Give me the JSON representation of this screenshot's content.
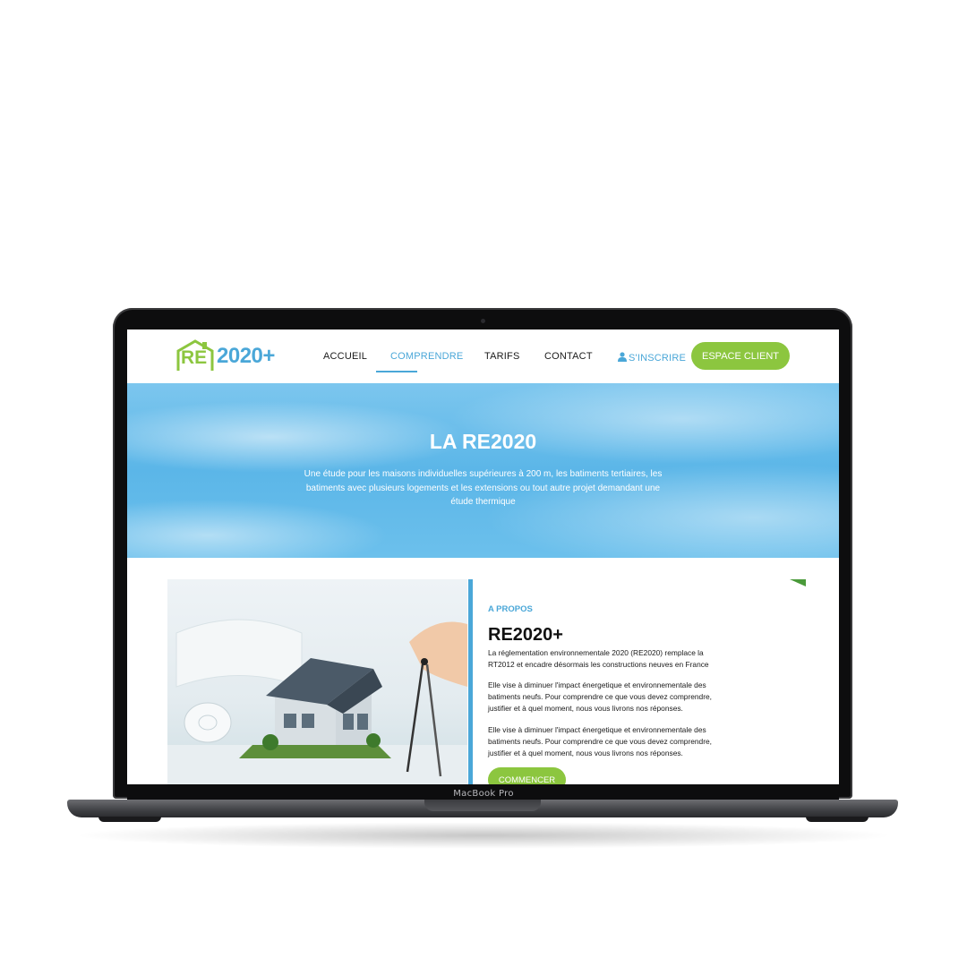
{
  "device": {
    "brand_label": "MacBook Pro"
  },
  "site": {
    "logo": {
      "re": "RE",
      "text": "2020+"
    },
    "nav": {
      "items": [
        "ACCUEIL",
        "COMPRENDRE",
        "TARIFS",
        "CONTACT"
      ],
      "active_item": "COMPRENDRE",
      "signup_label": "S'INSCRIRE",
      "cta_label": "ESPACE CLIENT"
    },
    "hero": {
      "title": "LA RE2020",
      "subtitle": "Une étude pour les maisons individuelles supérieures à 200 m, les batiments tertiaires, les batiments avec plusieurs logements et les extensions ou tout autre projet demandant une étude thermique"
    },
    "about": {
      "label": "A PROPOS",
      "title": "RE2020+",
      "paragraphs": [
        "La réglementation environnementale 2020 (RE2020) remplace la RT2012 et encadre désormais les constructions neuves en France",
        "Elle vise à diminuer l'impact énergetique et environnementale des batiments neufs. Pour comprendre ce que vous devez comprendre, justifier et à quel moment, nous vous livrons nos réponses.",
        "Elle vise à diminuer l'impact énergetique et environnementale des batiments neufs. Pour comprendre ce que vous devez comprendre, justifier et à quel moment, nous vous livrons nos réponses."
      ],
      "button_label": "COMMENCER",
      "image_icon": "house-model-with-compass-image"
    },
    "colors": {
      "accent_green": "#8cc63f",
      "accent_blue": "#4aa7d8"
    }
  }
}
